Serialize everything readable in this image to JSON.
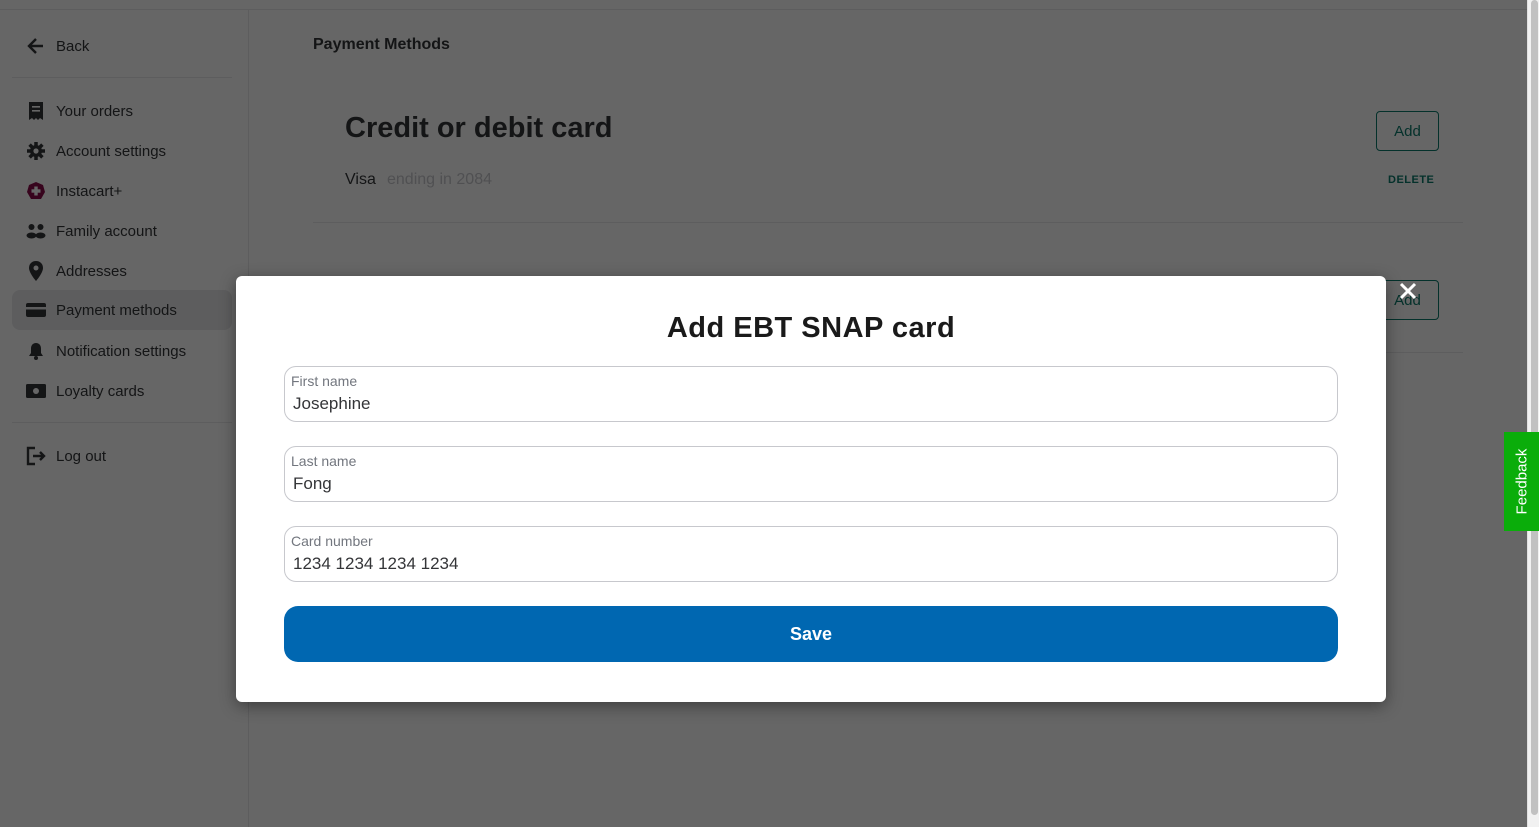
{
  "sidebar": {
    "back_label": "Back",
    "items": [
      {
        "label": "Your orders",
        "icon": "receipt-icon"
      },
      {
        "label": "Account settings",
        "icon": "gear-icon"
      },
      {
        "label": "Instacart+",
        "icon": "instacart-plus-icon"
      },
      {
        "label": "Family account",
        "icon": "people-icon"
      },
      {
        "label": "Addresses",
        "icon": "location-pin-icon"
      },
      {
        "label": "Payment methods",
        "icon": "credit-card-icon",
        "active": true
      },
      {
        "label": "Notification settings",
        "icon": "bell-icon"
      },
      {
        "label": "Loyalty cards",
        "icon": "loyalty-card-icon"
      }
    ],
    "logout_label": "Log out"
  },
  "main": {
    "title": "Payment Methods",
    "credit_section": {
      "title": "Credit or debit card",
      "add_label": "Add",
      "card_brand": "Visa",
      "card_ending": "ending in 2084",
      "delete_label": "DELETE"
    },
    "ebt_section": {
      "add_label": "Add"
    }
  },
  "modal": {
    "title": "Add EBT SNAP card",
    "fields": {
      "first_name": {
        "label": "First name",
        "value": "Josephine"
      },
      "last_name": {
        "label": "Last name",
        "value": "Fong"
      },
      "card_number": {
        "label": "Card number",
        "value": "1234 1234 1234 1234"
      }
    },
    "save_label": "Save"
  },
  "feedback_label": "Feedback",
  "colors": {
    "accent_teal": "#0a7a6b",
    "save_blue": "#0067b1",
    "feedback_green": "#0aad0a",
    "instacart_plus": "#8a0a4a"
  }
}
